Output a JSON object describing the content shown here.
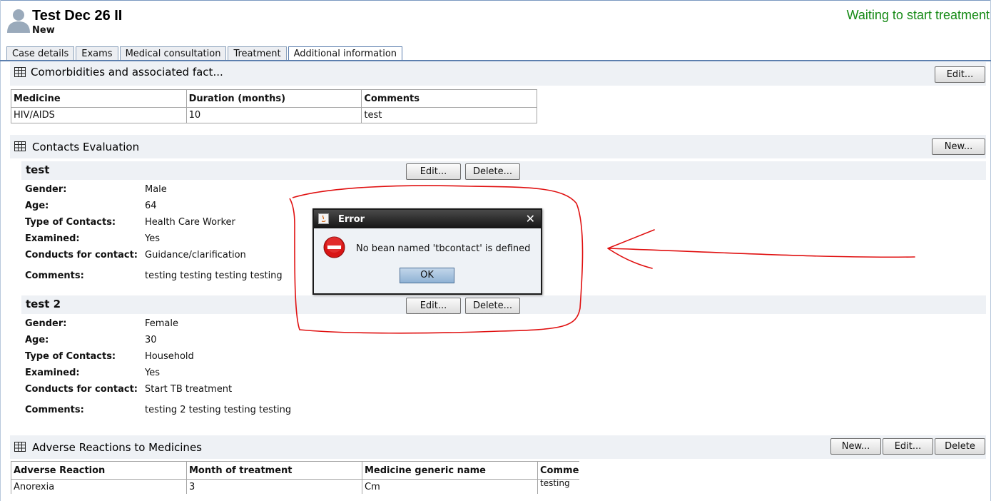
{
  "patient": {
    "name": "Test Dec 26 II",
    "status": "New"
  },
  "case_state": "Waiting to start treatment",
  "tabs": [
    {
      "label": "Case details"
    },
    {
      "label": "Exams"
    },
    {
      "label": "Medical consultation"
    },
    {
      "label": "Treatment"
    },
    {
      "label": "Additional information"
    }
  ],
  "comorbidities": {
    "title": "Comorbidities and associated fact...",
    "edit_label": "Edit...",
    "headers": [
      "Medicine",
      "Duration (months)",
      "Comments"
    ],
    "rows": [
      [
        "HIV/AIDS",
        "10",
        "test"
      ]
    ]
  },
  "contacts": {
    "title": "Contacts Evaluation",
    "new_label": "New...",
    "edit_label": "Edit...",
    "delete_label": "Delete...",
    "field_labels": {
      "gender": "Gender:",
      "age": "Age:",
      "type": "Type of Contacts:",
      "examined": "Examined:",
      "conducts": "Conducts for contact:",
      "comments": "Comments:"
    },
    "items": [
      {
        "name": "test",
        "gender": "Male",
        "age": "64",
        "type": "Health Care Worker",
        "examined": "Yes",
        "conducts": "Guidance/clarification",
        "comments": "testing testing testing testing"
      },
      {
        "name": "test 2",
        "gender": "Female",
        "age": "30",
        "type": "Household",
        "examined": "Yes",
        "conducts": "Start TB treatment",
        "comments": "testing 2 testing testing testing"
      }
    ]
  },
  "adverse": {
    "title": "Adverse Reactions to Medicines",
    "new_label": "New...",
    "edit_label": "Edit...",
    "delete_label": "Delete",
    "headers": [
      "Adverse Reaction",
      "Month of treatment",
      "Medicine generic name",
      "Comme"
    ],
    "rows": [
      [
        "Anorexia",
        "3",
        "Cm",
        "testing"
      ]
    ]
  },
  "dialog": {
    "title": "Error",
    "message": "No bean named 'tbcontact' is defined",
    "ok_label": "OK"
  },
  "colors": {
    "case_state": "#168a16",
    "annotation": "#e01010",
    "tab_border": "#5c7fae"
  }
}
